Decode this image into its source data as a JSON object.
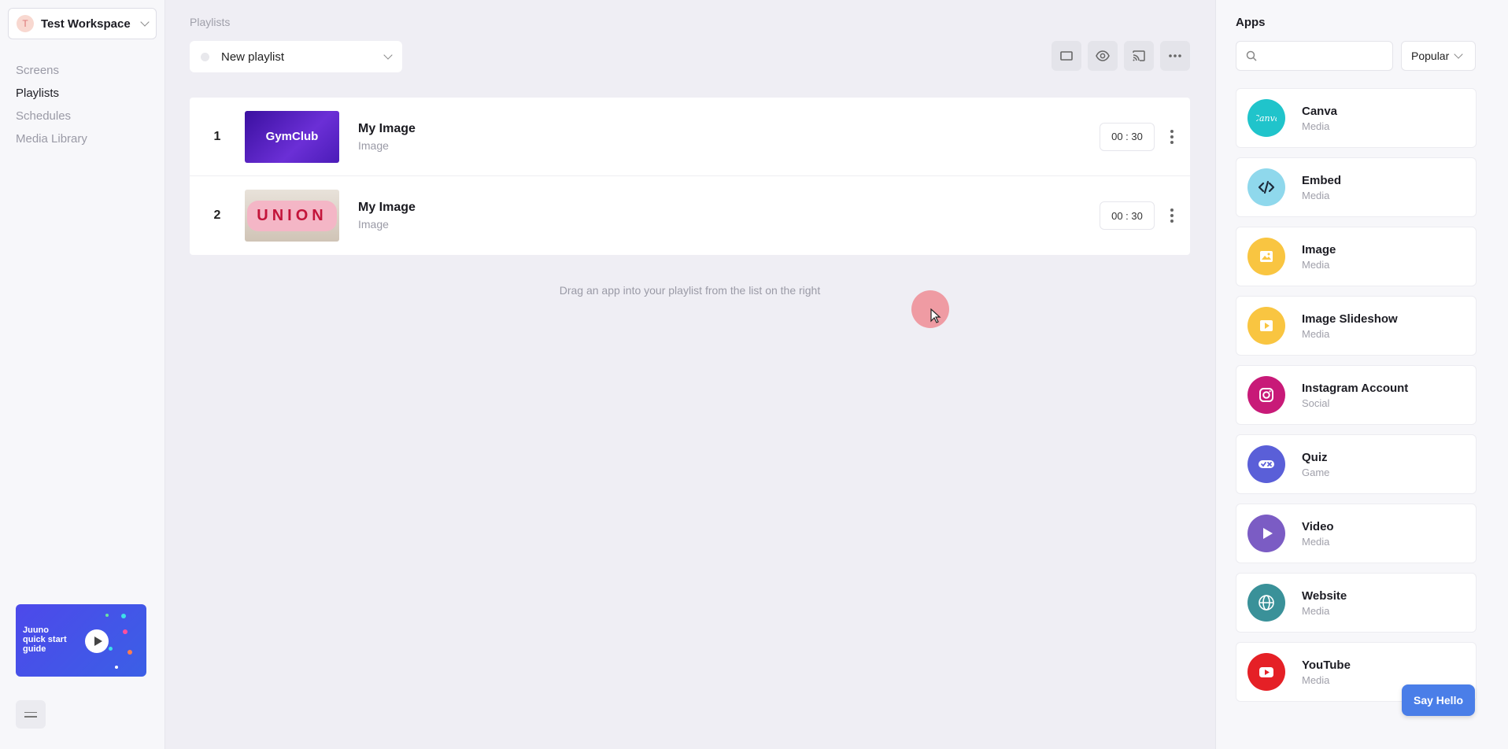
{
  "workspace": {
    "avatar_letter": "T",
    "name": "Test Workspace"
  },
  "nav": [
    {
      "label": "Screens",
      "active": false
    },
    {
      "label": "Playlists",
      "active": true
    },
    {
      "label": "Schedules",
      "active": false
    },
    {
      "label": "Media Library",
      "active": false
    }
  ],
  "guide": {
    "title": "Juuno quick start guide"
  },
  "breadcrumb": "Playlists",
  "playlist_select": {
    "name": "New playlist"
  },
  "toolbar": {
    "icons": [
      "rectangle-icon",
      "eye-icon",
      "cast-icon",
      "more-icon"
    ]
  },
  "playlist_items": [
    {
      "index": "1",
      "title": "My Image",
      "type": "Image",
      "duration": "00 : 30",
      "thumb_text": "GymClub"
    },
    {
      "index": "2",
      "title": "My Image",
      "type": "Image",
      "duration": "00 : 30",
      "thumb_text": "UNION"
    }
  ],
  "hint": "Drag an app into your playlist from the list on the right",
  "apps": {
    "title": "Apps",
    "search_placeholder": "",
    "sort_label": "Popular",
    "items": [
      {
        "name": "Canva",
        "category": "Media",
        "color": "#20c4cb"
      },
      {
        "name": "Embed",
        "category": "Media",
        "color": "#8fd8ec"
      },
      {
        "name": "Image",
        "category": "Media",
        "color": "#f9c541"
      },
      {
        "name": "Image Slideshow",
        "category": "Media",
        "color": "#f9c541"
      },
      {
        "name": "Instagram Account",
        "category": "Social",
        "color": "#c81a78"
      },
      {
        "name": "Quiz",
        "category": "Game",
        "color": "#5a5fd8"
      },
      {
        "name": "Video",
        "category": "Media",
        "color": "#7b5cc4"
      },
      {
        "name": "Website",
        "category": "Media",
        "color": "#3a9199"
      },
      {
        "name": "YouTube",
        "category": "Media",
        "color": "#e52026"
      }
    ]
  },
  "say_hello": "Say Hello"
}
